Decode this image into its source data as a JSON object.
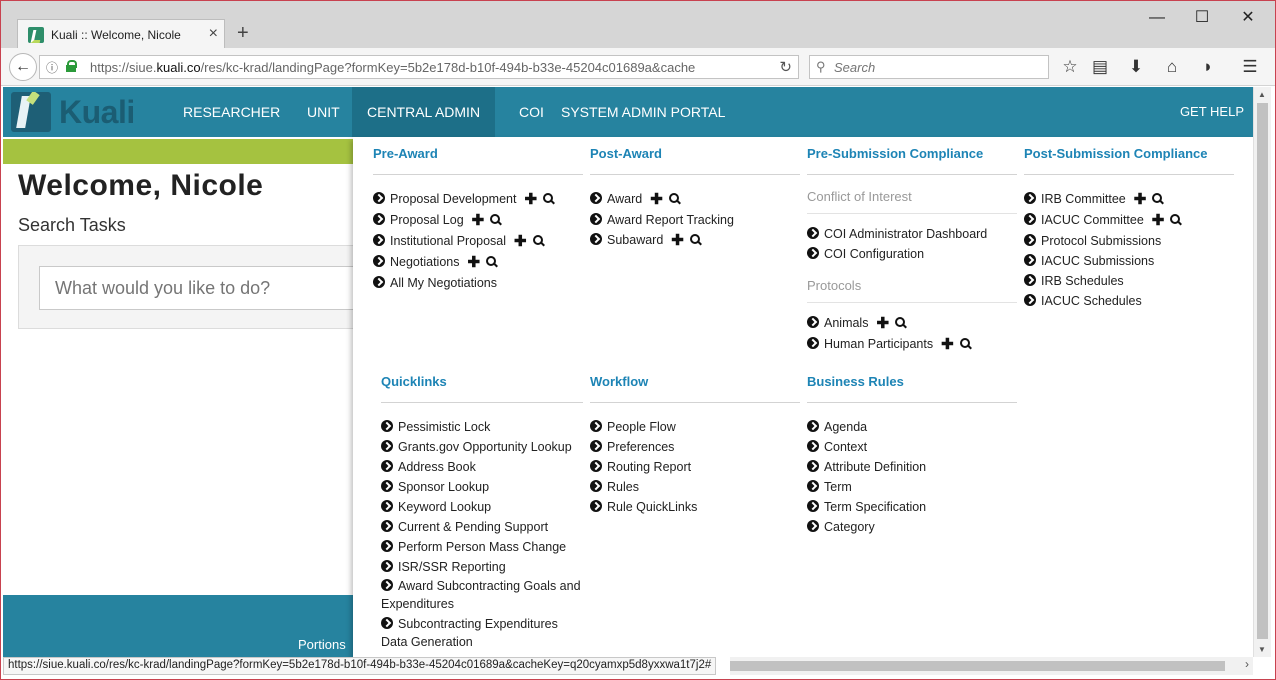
{
  "browser": {
    "tab_title": "Kuali :: Welcome, Nicole",
    "tab_close": "×",
    "new_tab": "+",
    "url_prefix": "https://siue.",
    "url_domain": "kuali.co",
    "url_rest": "/res/kc-krad/landingPage?formKey=5b2e178d-b10f-494b-b33e-45204c01689a&cache",
    "search_placeholder": "Search",
    "window_minimize": "—",
    "window_maximize": "☐",
    "window_close": "✕",
    "status_url": "https://siue.kuali.co/res/kc-krad/landingPage?formKey=5b2e178d-b10f-494b-b33e-45204c01689a&cacheKey=q20cyamxp5d8yxxwa1t7j2#"
  },
  "app": {
    "logo_text": "Kuali",
    "nav": [
      "RESEARCHER",
      "UNIT",
      "CENTRAL ADMIN",
      "COI",
      "SYSTEM ADMIN PORTAL"
    ],
    "active_nav": "CENTRAL ADMIN",
    "get_help": "GET HELP",
    "welcome": "Welcome, Nicole",
    "search_tasks": "Search Tasks",
    "task_placeholder": "What would you like to do?",
    "footer_text": "Portions"
  },
  "menu": {
    "pre_award": {
      "title": "Pre-Award",
      "items": [
        "Proposal Development",
        "Proposal Log",
        "Institutional Proposal",
        "Negotiations",
        "All My Negotiations"
      ]
    },
    "post_award": {
      "title": "Post-Award",
      "items": [
        "Award",
        "Award Report Tracking",
        "Subaward"
      ]
    },
    "pre_submission": {
      "title": "Pre-Submission Compliance",
      "coi_heading": "Conflict of Interest",
      "coi_items": [
        "COI Administrator Dashboard",
        "COI Configuration"
      ],
      "protocols_heading": "Protocols",
      "protocol_items": [
        "Animals",
        "Human Participants"
      ]
    },
    "post_submission": {
      "title": "Post-Submission Compliance",
      "items": [
        "IRB Committee",
        "IACUC Committee",
        "Protocol Submissions",
        "IACUC Submissions",
        "IRB Schedules",
        "IACUC Schedules"
      ]
    },
    "quicklinks": {
      "title": "Quicklinks",
      "items": [
        "Pessimistic Lock",
        "Grants.gov Opportunity Lookup",
        "Address Book",
        "Sponsor Lookup",
        "Keyword Lookup",
        "Current & Pending Support",
        "Perform Person Mass Change",
        "ISR/SSR Reporting",
        "Award Subcontracting Goals and Expenditures",
        "Subcontracting Expenditures Data Generation"
      ]
    },
    "workflow": {
      "title": "Workflow",
      "items": [
        "People Flow",
        "Preferences",
        "Routing Report",
        "Rules",
        "Rule QuickLinks"
      ]
    },
    "business_rules": {
      "title": "Business Rules",
      "items": [
        "Agenda",
        "Context",
        "Attribute Definition",
        "Term",
        "Term Specification",
        "Category"
      ]
    }
  },
  "colors": {
    "nav_bg": "#26839f",
    "nav_active": "#1d6f88",
    "menu_heading": "#1d84b5",
    "green_bar": "#a5c240"
  }
}
